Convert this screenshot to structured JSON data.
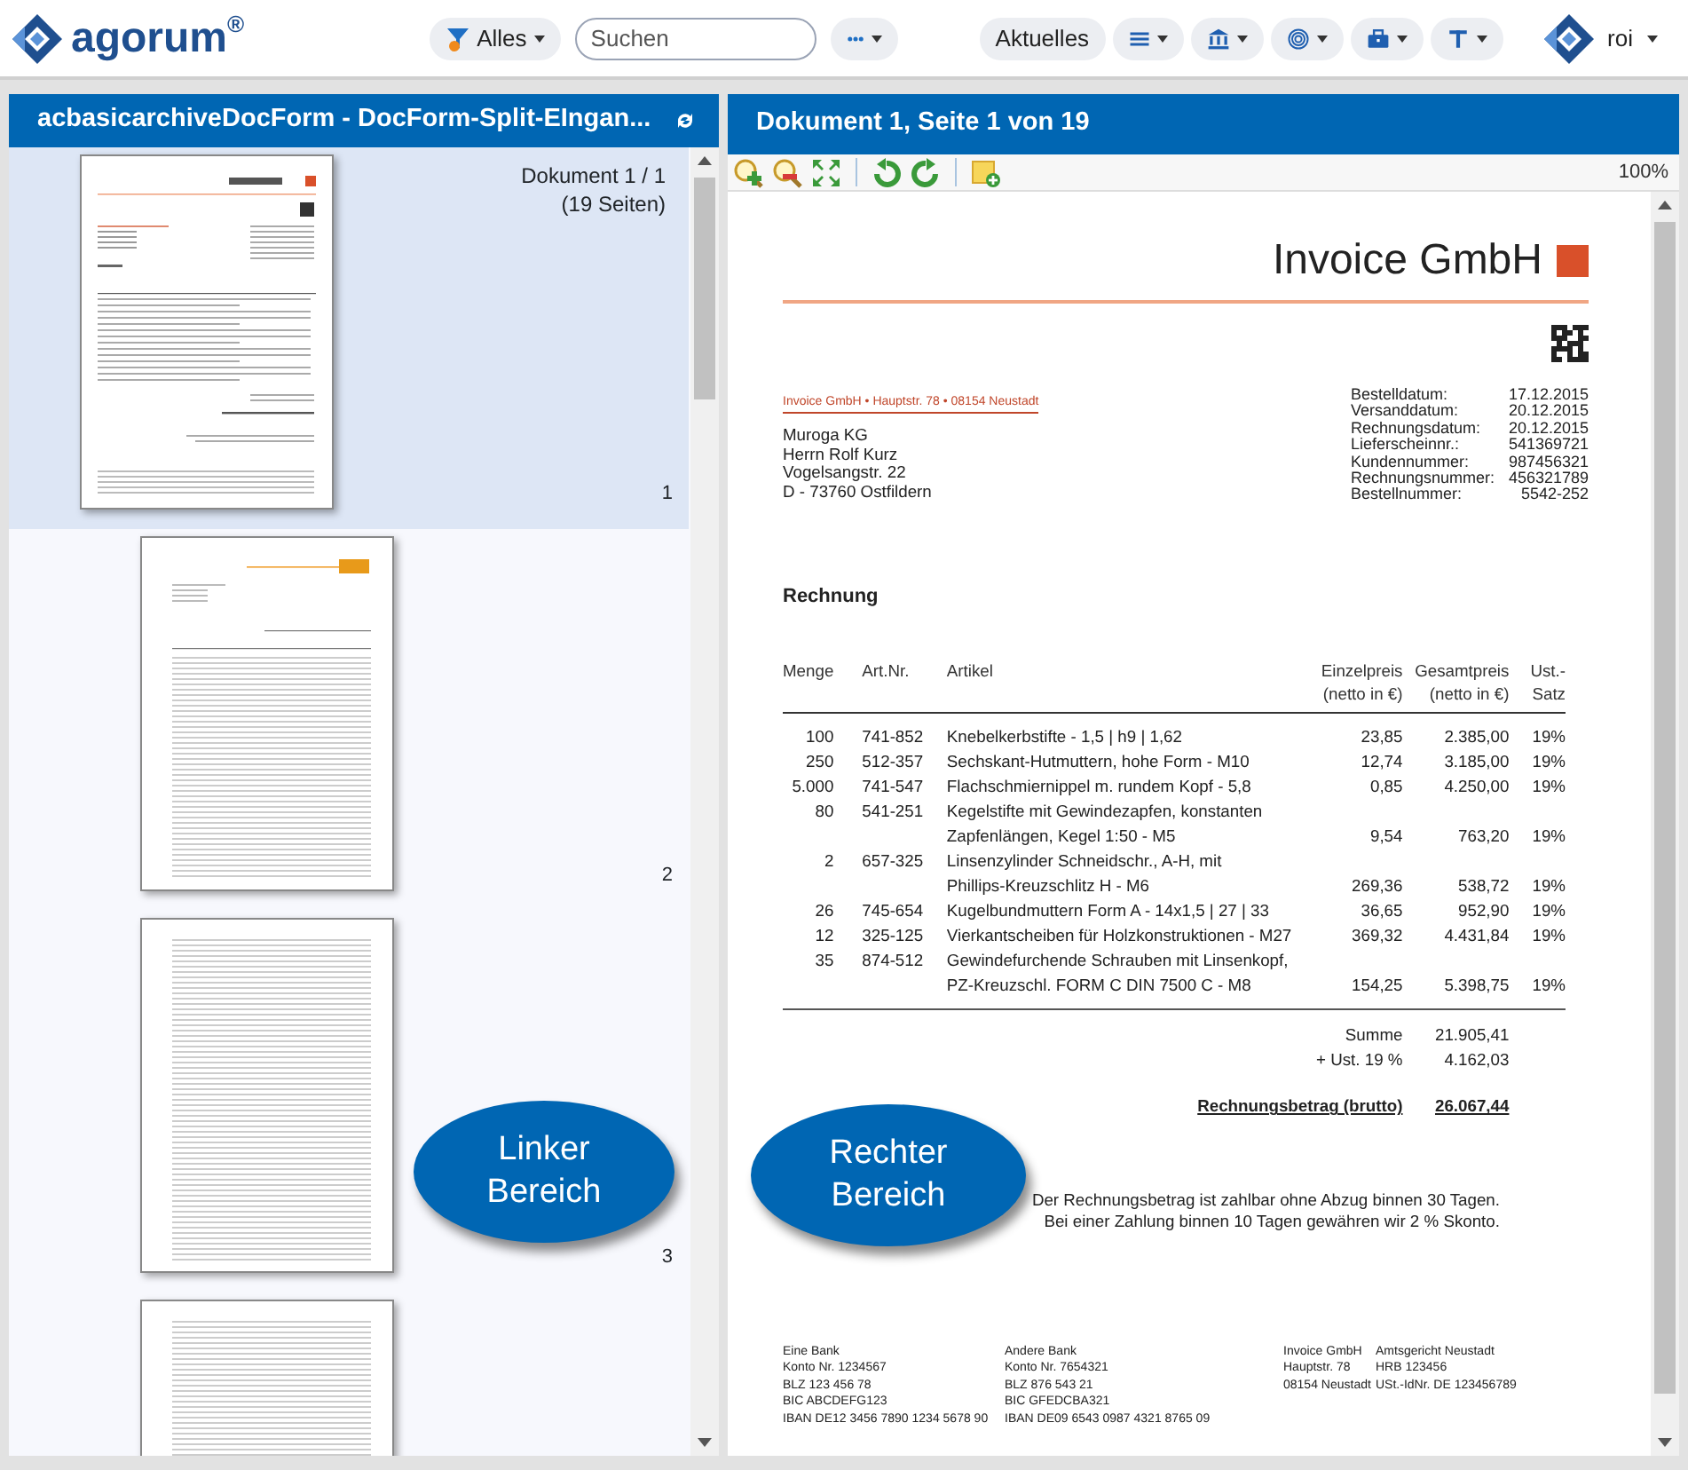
{
  "top_bar": {
    "logo": "agorum$^{®}$",
    "filter_button": "Alles",
    "search": {
      "placeholder": "Suchen"
    },
    "news_button": "Aktuelles",
    "user": "roi"
  },
  "left_panel": {
    "title": "acbasicarchiveDocForm - DocForm-Split-EIngan...",
    "doc_info": [
      "Dokument 1 / 1",
      "(19 Seiten)"
    ],
    "pages": [
      {
        "number": "1",
        "selected": true,
        "kind": "invoice"
      },
      {
        "number": "2",
        "selected": false,
        "kind": "table"
      },
      {
        "number": "3",
        "selected": false,
        "kind": "list"
      },
      {
        "selected": false,
        "kind": "list"
      }
    ]
  },
  "callouts": [
    {
      "text": "Linker Bereich"
    },
    {
      "text": "Rechter Bereich"
    }
  ],
  "right_panel": {
    "title": "Dokument 1, Seite 1 von 19",
    "zoom": "100%",
    "document": {
      "company": "Invoice GmbH",
      "sender_line": "Invoice GmbH • Hauptstr. 78 • 08154 Neustadt",
      "recipient": [
        "Muroga KG",
        "Herrn Rolf Kurz",
        "Vogelsangstr. 22",
        "D - 73760 Ostfildern"
      ],
      "meta": [
        {
          "label": "Bestelldatum:",
          "value": "17.12.2015"
        },
        {
          "label": "Versanddatum:",
          "value": "20.12.2015"
        },
        {
          "label": "Rechnungsdatum:",
          "value": "20.12.2015"
        },
        {
          "label": "Lieferscheinnr.:",
          "value": "541369721"
        },
        {
          "label": "Kundennummer:",
          "value": "987456321"
        },
        {
          "label": "Rechnungsnummer:",
          "value": "456321789"
        },
        {
          "label": "Bestellnummer:",
          "value": "5542-252"
        }
      ],
      "heading": "Rechnung",
      "columns": [
        [
          "Menge"
        ],
        [
          "Art.Nr."
        ],
        [
          "Artikel"
        ],
        [
          "Einzelpreis",
          "(netto in €)"
        ],
        [
          "Gesamtpreis",
          "(netto in €)"
        ],
        [
          "Ust.-",
          "Satz"
        ]
      ],
      "rows": [
        {
          "qty": "100",
          "art": "741-852",
          "article": [
            "Knebelkerbstifte - 1,5 | h9 | 1,62"
          ],
          "unit": "23,85",
          "total": "2.385,00",
          "vat": "19%"
        },
        {
          "qty": "250",
          "art": "512-357",
          "article": [
            "Sechskant-Hutmuttern, hohe Form - M10"
          ],
          "unit": "12,74",
          "total": "3.185,00",
          "vat": "19%"
        },
        {
          "qty": "5.000",
          "art": "741-547",
          "article": [
            "Flachschmiernippel m. rundem Kopf - 5,8"
          ],
          "unit": "0,85",
          "total": "4.250,00",
          "vat": "19%"
        },
        {
          "qty": "80",
          "art": "541-251",
          "article": [
            "Kegelstifte mit Gewindezapfen, konstanten",
            "Zapfenlängen, Kegel 1:50 - M5"
          ],
          "unit": "9,54",
          "total": "763,20",
          "vat": "19%"
        },
        {
          "qty": "2",
          "art": "657-325",
          "article": [
            "Linsenzylinder Schneidschr., A-H, mit",
            "Phillips-Kreuzschlitz H - M6"
          ],
          "unit": "269,36",
          "total": "538,72",
          "vat": "19%"
        },
        {
          "qty": "26",
          "art": "745-654",
          "article": [
            "Kugelbundmuttern Form A - 14x1,5 | 27 | 33"
          ],
          "unit": "36,65",
          "total": "952,90",
          "vat": "19%"
        },
        {
          "qty": "12",
          "art": "325-125",
          "article": [
            "Vierkantscheiben für Holzkonstruktionen - M27"
          ],
          "unit": "369,32",
          "total": "4.431,84",
          "vat": "19%"
        },
        {
          "qty": "35",
          "art": "874-512",
          "article": [
            "Gewindefurchende Schrauben mit Linsenkopf,",
            "PZ-Kreuzschl. FORM C DIN 7500 C - M8"
          ],
          "unit": "154,25",
          "total": "5.398,75",
          "vat": "19%"
        }
      ],
      "totals": [
        {
          "label": "Summe",
          "value": "21.905,41"
        },
        {
          "label": "+ Ust. 19 %",
          "value": "4.162,03"
        }
      ],
      "grand_total": {
        "label": "Rechnungsbetrag (brutto)",
        "value": "26.067,44"
      },
      "payment_note": [
        "Der Rechnungsbetrag ist zahlbar ohne Abzug binnen 30 Tagen.",
        "Bei einer Zahlung binnen 10 Tagen gewähren wir 2 % Skonto."
      ],
      "footer": [
        [
          "Eine Bank",
          "Konto Nr. 1234567",
          "BLZ 123 456 78",
          "BIC ABCDEFG123",
          "IBAN DE12 3456 7890 1234 5678 90"
        ],
        [
          "Andere Bank",
          "Konto Nr. 7654321",
          "BLZ 876 543 21",
          "BIC GFEDCBA321",
          "IBAN DE09 6543 0987 4321 8765 09"
        ],
        [
          "Invoice GmbH",
          "Hauptstr. 78",
          "08154 Neustadt"
        ],
        [
          "Amtsgericht Neustadt",
          "HRB 123456",
          "USt.-IdNr. DE 123456789"
        ]
      ]
    }
  }
}
